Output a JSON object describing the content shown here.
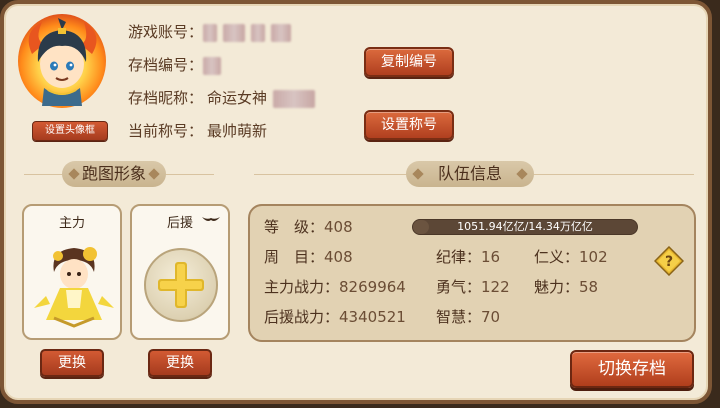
{
  "profile": {
    "set_avatar_frame_label": "设置头像框",
    "account_label": "游戏账号：",
    "save_id_label": "存档编号：",
    "save_nickname_label": "存档昵称：",
    "save_nickname_value": "命运女神",
    "title_label": "当前称号：",
    "title_value": "最帅萌新",
    "copy_id_button": "复制编号",
    "set_title_button": "设置称号"
  },
  "run_image": {
    "section_title": "跑图形象",
    "main_slot_label": "主力",
    "support_slot_label": "后援",
    "swap_label_1": "更换",
    "swap_label_2": "更换"
  },
  "team_info": {
    "section_title": "队伍信息",
    "level_label": "等　级：",
    "level_value": "408",
    "exp_text": "1051.94亿亿/14.34万亿亿",
    "exp_fraction": 0.07,
    "cycle_label": "周　目：",
    "cycle_value": "408",
    "discipline_label": "纪律：",
    "discipline_value": "16",
    "benevolence_label": "仁义：",
    "benevolence_value": "102",
    "main_power_label": "主力战力：",
    "main_power_value": "8269964",
    "courage_label": "勇气：",
    "courage_value": "122",
    "charm_label": "魅力：",
    "charm_value": "58",
    "support_power_label": "后援战力：",
    "support_power_value": "4340521",
    "wisdom_label": "智慧：",
    "wisdom_value": "70"
  },
  "switch_save_button": "切换存档",
  "colors": {
    "panel_bg": "#f3ead7",
    "button_red": "#b03f1f",
    "text_brown": "#5a3b24"
  }
}
